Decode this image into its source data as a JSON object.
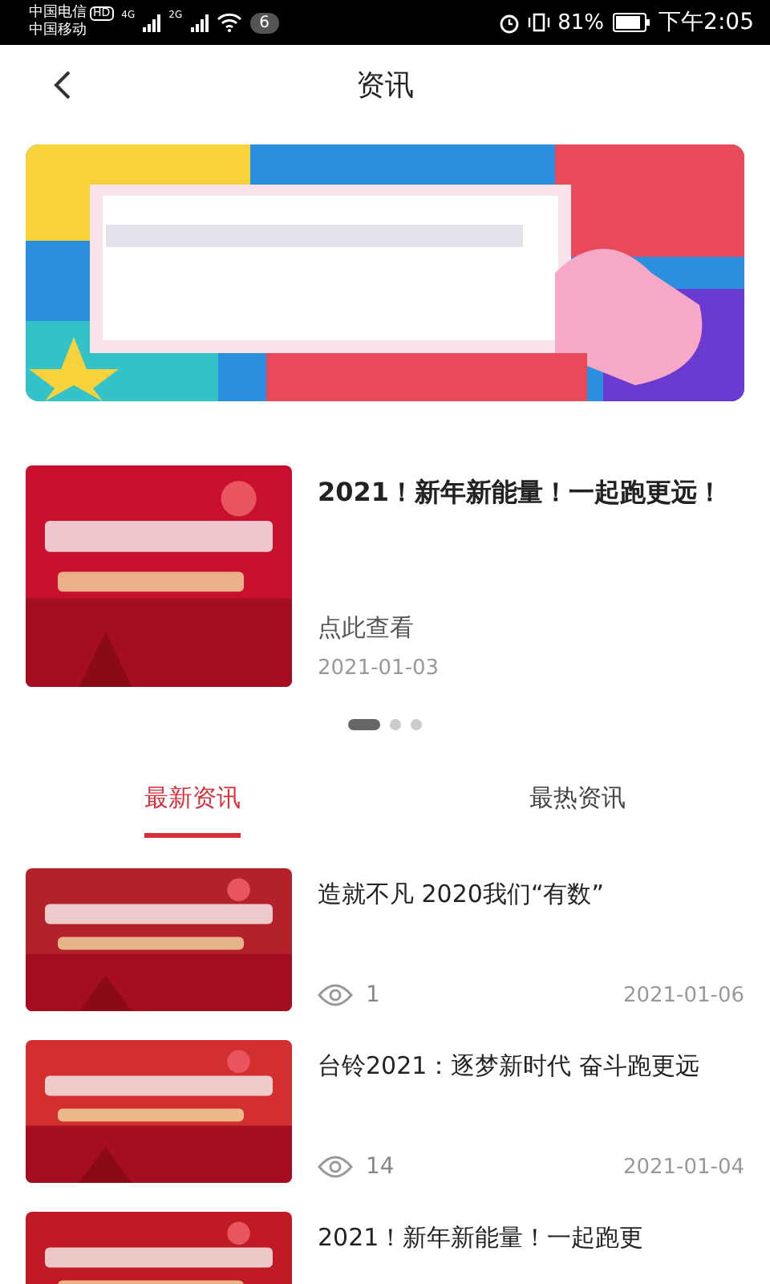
{
  "status_bar": {
    "carrier_1": "中国电信",
    "hd_badge": "HD",
    "carrier_2": "中国移动",
    "network_1": "4G",
    "network_2": "2G",
    "notification_count": "6",
    "battery": "81%",
    "time": "下午2:05"
  },
  "header": {
    "title": "资讯"
  },
  "carousel": {
    "slide": {
      "title": "2021！新年新能量！一起跑更远！",
      "link": "点此查看",
      "date": "2021-01-03"
    },
    "dots": [
      {
        "selected": true
      },
      {
        "selected": false
      },
      {
        "selected": false
      }
    ]
  },
  "tabs": [
    {
      "label": "最新资讯",
      "selected": true
    },
    {
      "label": "最热资讯",
      "selected": false
    }
  ],
  "news": [
    {
      "title": "造就不凡 2020我们“有数”",
      "views": "1",
      "date": "2021-01-06"
    },
    {
      "title": "台铃2021：逐梦新时代 奋斗跑更远",
      "views": "14",
      "date": "2021-01-04"
    },
    {
      "title": "2021！新年新能量！一起跑更"
    }
  ]
}
